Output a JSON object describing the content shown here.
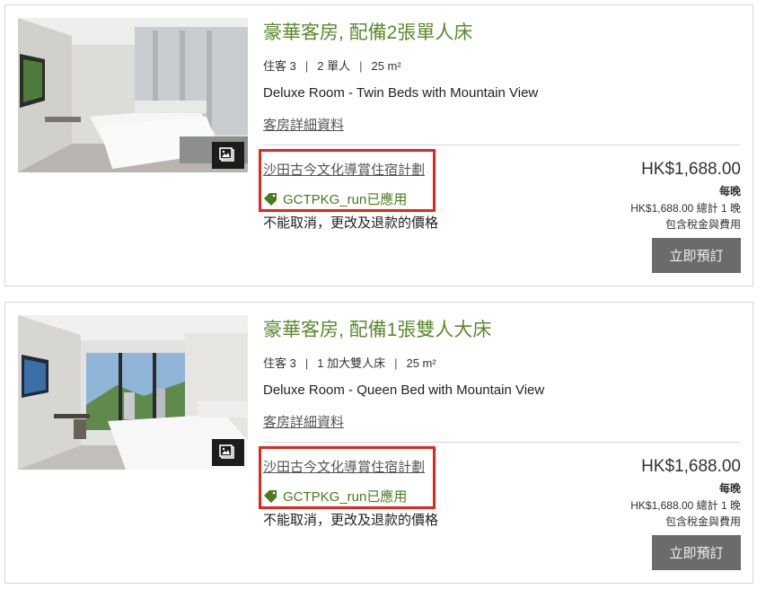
{
  "rooms": [
    {
      "title": "豪華客房, 配備2張單人床",
      "guests": "住客 3",
      "bed": "2 單人",
      "size": "25 m²",
      "name_en": "Deluxe Room - Twin Beds with Mountain View",
      "details_link": "客房詳細資料",
      "plan_link": "沙田古今文化導賞住宿計劃",
      "promo_code": "GCTPKG_run已應用",
      "cancel_note": "不能取消，更改及退款的價格",
      "price": "HK$1,688.00",
      "per_night": "每晚",
      "total": "HK$1,688.00 總計 1 晚",
      "tax": "包含稅金與費用",
      "book_label": "立即預訂"
    },
    {
      "title": "豪華客房, 配備1張雙人大床",
      "guests": "住客 3",
      "bed": "1 加大雙人床",
      "size": "25 m²",
      "name_en": "Deluxe Room - Queen Bed with Mountain View",
      "details_link": "客房詳細資料",
      "plan_link": "沙田古今文化導賞住宿計劃",
      "promo_code": "GCTPKG_run已應用",
      "cancel_note": "不能取消，更改及退款的價格",
      "price": "HK$1,688.00",
      "per_night": "每晚",
      "total": "HK$1,688.00 總計 1 晚",
      "tax": "包含稅金與費用",
      "book_label": "立即預訂"
    }
  ],
  "spec_separator": "|",
  "icons": {
    "gallery": "gallery-icon",
    "tag": "tag-icon"
  },
  "colors": {
    "title_green": "#5a8a2c",
    "promo_green": "#4a7a1e",
    "highlight_red": "#e2261c",
    "button_gray": "#6b6b6b"
  }
}
